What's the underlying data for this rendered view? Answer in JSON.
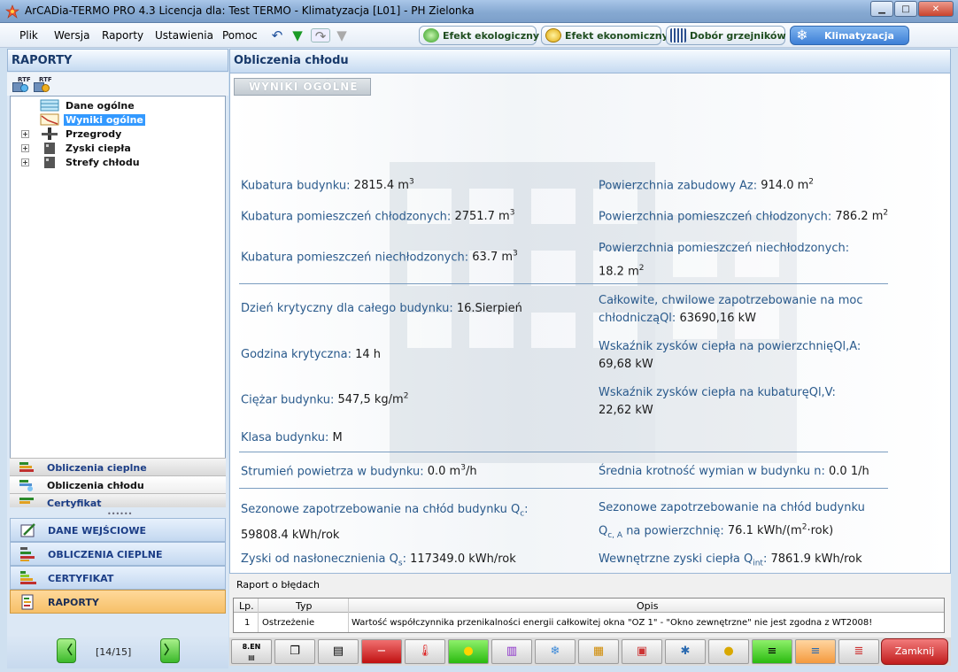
{
  "window": {
    "title": "ArCADia-TERMO PRO 4.3 Licencja dla: Test TERMO - Klimatyzacja [L01] - PH Zielonka",
    "controls": [
      "minimize",
      "maximize",
      "close"
    ]
  },
  "menu": {
    "items": [
      "Plik",
      "Wersja",
      "Raporty",
      "Ustawienia",
      "Pomoc"
    ],
    "toolbar_icons": [
      "undo-icon",
      "down-arrow-icon",
      "redo-icon",
      "down-arrow-disabled-icon"
    ],
    "modes": [
      {
        "label": "Efekt ekologiczny",
        "icon": "leaf-icon",
        "active": false
      },
      {
        "label": "Efekt ekonomiczny",
        "icon": "coin-icon",
        "active": false
      },
      {
        "label": "Dobór grzejników",
        "icon": "radiator-icon",
        "active": false
      },
      {
        "label": "Klimatyzacja",
        "icon": "snowflake-icon",
        "active": true
      }
    ]
  },
  "left": {
    "header": "RAPORTY",
    "rtf_buttons": [
      "RTF",
      "RTF"
    ],
    "tree": [
      {
        "label": "Dane ogólne",
        "expandable": false,
        "selected": false
      },
      {
        "label": "Wyniki ogólne",
        "expandable": false,
        "selected": true
      },
      {
        "label": "Przegrody",
        "expandable": true,
        "selected": false
      },
      {
        "label": "Zyski ciepła",
        "expandable": true,
        "selected": false
      },
      {
        "label": "Strefy chłodu",
        "expandable": true,
        "selected": false
      }
    ],
    "subtabs": [
      {
        "label": "Obliczenia cieplne",
        "active": false
      },
      {
        "label": "Obliczenia chłodu",
        "active": true
      },
      {
        "label": "Certyfikat",
        "active": false
      }
    ],
    "nav": [
      {
        "label": "DANE WEJŚCIOWE",
        "active": false
      },
      {
        "label": "OBLICZENIA CIEPLNE",
        "active": false
      },
      {
        "label": "CERTYFIKAT",
        "active": false
      },
      {
        "label": "RAPORTY",
        "active": true
      }
    ],
    "pager": {
      "text": "[14/15]",
      "prev": "〈",
      "next": "〉"
    }
  },
  "right": {
    "header": "Obliczenia chłodu",
    "section_badge": "WYNIKI OGÓLNE",
    "rows": {
      "kubatura": {
        "label": "Kubatura budynku: ",
        "value": "2815.4 m",
        "sup": "3"
      },
      "pow_zab": {
        "label": "Powierzchnia zabudowy Az: ",
        "value": "914.0 m",
        "sup": "2"
      },
      "kub_chl": {
        "label": "Kubatura pomieszczeń chłodzonych: ",
        "value": "2751.7 m",
        "sup": "3"
      },
      "pow_chl": {
        "label": "Powierzchnia pomieszczeń chłodzonych: ",
        "value": "786.2 m",
        "sup": "2"
      },
      "kub_niechl": {
        "label": "Kubatura pomieszczeń niechłodzonych: ",
        "value": "63.7 m",
        "sup": "3"
      },
      "pow_niechl": {
        "label": "Powierzchnia pomieszczeń niechłodzonych:",
        "value": "18.2 m",
        "sup": "2"
      },
      "dzien": {
        "label": "Dzień krytyczny dla całego budynku: ",
        "value": "16.Sierpień"
      },
      "calkowite": {
        "label1": "Całkowite, chwilowe zapotrzebowanie na moc",
        "label2": "chłodnicząQl: ",
        "value": "63690,16 kW"
      },
      "godzina": {
        "label": "Godzina krytyczna: ",
        "value": "14 h"
      },
      "wsk_pow": {
        "label": "Wskaźnik zysków ciepła na powierzchnięQl,A:",
        "value": "69,68 kW"
      },
      "ciezar": {
        "label": "Ciężar budynku: ",
        "value": "547,5 kg/m",
        "sup": "2"
      },
      "wsk_kub": {
        "label": "Wskaźnik zysków ciepła na kubaturęQl,V:",
        "value": "22,62 kW"
      },
      "klasa": {
        "label": "Klasa budynku: ",
        "value": "M"
      },
      "strumien": {
        "label": "Strumień powietrza w budynku: ",
        "value_pre": "0.0 m",
        "sup": "3",
        "value_post": "/h"
      },
      "krotnosc": {
        "label": "Średnia krotność wymian w budynku n: ",
        "value": "0.0 1/h"
      },
      "sez_bud": {
        "label": "Sezonowe zapotrzebowanie na chłód budynku Q",
        "sub": "c",
        "colon": ":",
        "value": "59808.4 kWh/rok"
      },
      "sez_pow": {
        "label1": "Sezonowe zapotrzebowanie na chłód budynku",
        "label2_pre": "Q",
        "sub": "c, A",
        "label2_post": " na powierzchnię: ",
        "value_pre": "76.1 kWh/(m",
        "sup": "2",
        "value_post": "·rok)"
      },
      "zyski_nas": {
        "label_pre": "Zyski od nasłonecznienia Q",
        "sub": "s",
        "label_post": ": ",
        "value": "117349.0 kWh/rok"
      },
      "zyski_wew": {
        "label_pre": "Wewnętrzne zyski ciepła Q",
        "sub": "int",
        "label_post": ": ",
        "value": "7861.9 kWh/rok"
      }
    }
  },
  "errors": {
    "title": "Raport o błędach",
    "columns": [
      "Lp.",
      "Typ",
      "Opis"
    ],
    "rows": [
      {
        "lp": "1",
        "typ": "Ostrzeżenie",
        "opis": "Wartość współczynnika przenikalności energii całkowitej okna \"OZ 1\" - \"Okno zewnętrzne\" nie jest zgodna z WT2008!"
      }
    ]
  },
  "bottom": {
    "buttons": [
      "8.EN"
    ],
    "close_label": "Zamknij"
  },
  "colors": {
    "accent": "#3d7fd6",
    "label": "#2a5a8c",
    "nav_active": "#f6c068"
  }
}
